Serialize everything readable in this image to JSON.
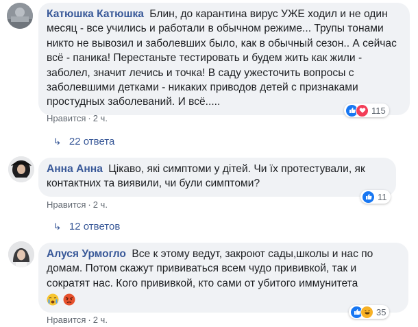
{
  "comments": [
    {
      "author": "Катюшка Катюшка",
      "text": "Блин, до карантина вирус УЖЕ ходил и не один месяц - все учились и работали в обычном режиме... Трупы тонами никто не вывозил и заболевших было, как в обычный сезон.. А сейчас всё - паника! Перестаньте тестировать и будем жить как жили - заболел, значит лечись и точка! В саду ужесточить вопросы с заболевшими детками - никаких приводов детей с признаками простудных заболеваний. И всё.....",
      "like_label": "Нравится",
      "time": "2 ч.",
      "reaction_count": "115",
      "reactions": [
        "like-icon",
        "love-icon"
      ],
      "replies_label": "22 ответа"
    },
    {
      "author": "Анна Анна",
      "text": "Цікаво, які симптоми у дітей. Чи їх протестували, як контактних та виявили, чи були симптоми?",
      "like_label": "Нравится",
      "time": "2 ч.",
      "reaction_count": "11",
      "reactions": [
        "like-icon"
      ],
      "replies_label": "12 ответов"
    },
    {
      "author": "Алуся Урмогло",
      "text": "Все к этому ведут, закроют сады,школы и нас по домам. Потом скажут прививаться всем чудо прививкой, так и сократят нас. Кого прививкой, кто сами от убитого иммунитета",
      "emojis": [
        "crying-face-emoji",
        "angry-face-emoji"
      ],
      "like_label": "Нравится",
      "time": "2 ч.",
      "reaction_count": "35",
      "reactions": [
        "like-icon",
        "haha-icon"
      ]
    }
  ],
  "colors": {
    "author": "#385898",
    "bubble": "#f0f2f5",
    "meta": "#606770",
    "like_blue": "#1877f2",
    "love_red": "#f33e58",
    "haha_yellow": "#f7b125"
  }
}
